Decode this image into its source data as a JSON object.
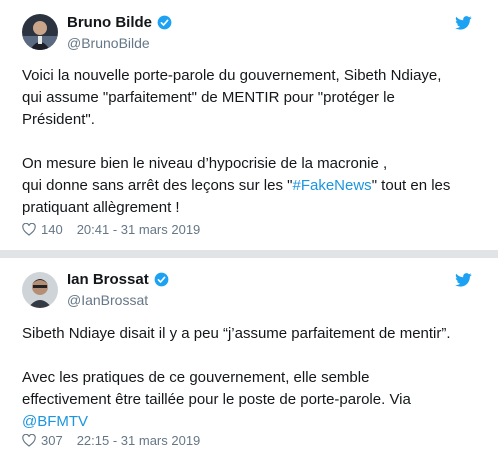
{
  "colors": {
    "link": "#1b95e0",
    "verified": "#1da1f2",
    "twitter_bird": "#1da1f2",
    "secondary_text": "#657786",
    "separator": "#e1e4e6"
  },
  "icons": {
    "verified": "verified-badge-icon",
    "twitter": "twitter-bird-icon",
    "like": "heart-icon"
  },
  "tweets": [
    {
      "author": {
        "name": "Bruno Bilde",
        "handle": "@BrunoBilde"
      },
      "lines": [
        "Voici la nouvelle porte-parole du gouvernement, Sibeth Ndiaye,",
        "qui assume \"parfaitement\" de MENTIR pour \"protéger le",
        "Président\".",
        "On mesure bien le niveau d’hypocrisie de la macronie ,"
      ],
      "line5_before": "qui donne sans arrêt des leçons sur les \"",
      "hashtag": "#FakeNews",
      "line5_after": "\" tout en les",
      "line6": "pratiquant allègrement !",
      "likes": "140",
      "timestamp": "20:41 - 31 mars 2019"
    },
    {
      "author": {
        "name": "Ian Brossat",
        "handle": "@IanBrossat"
      },
      "lines": [
        "Sibeth Ndiaye disait il y a peu “j’assume parfaitement de mentir”.",
        "Avec les pratiques de ce gouvernement, elle semble",
        "effectivement être taillée pour le poste de porte-parole. Via"
      ],
      "mention": "@BFMTV",
      "likes": "307",
      "timestamp": "22:15 - 31 mars 2019"
    }
  ]
}
